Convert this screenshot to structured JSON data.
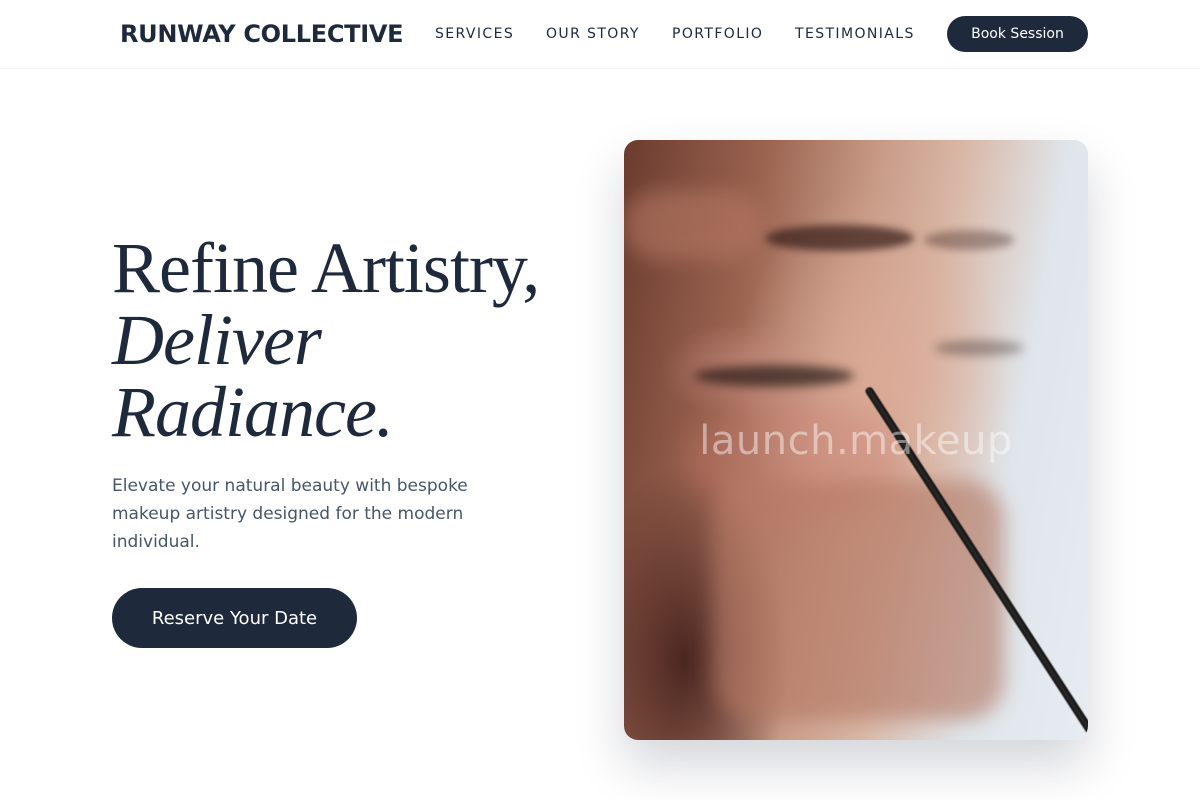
{
  "header": {
    "brand": "RUNWAY COLLECTIVE",
    "nav": [
      {
        "label": "SERVICES"
      },
      {
        "label": "OUR STORY"
      },
      {
        "label": "PORTFOLIO"
      },
      {
        "label": "TESTIMONIALS"
      }
    ],
    "book_label": "Book Session"
  },
  "hero": {
    "headline_line1": "Refine Artistry,",
    "headline_line2": "Deliver",
    "headline_line3": "Radiance.",
    "subtext": "Elevate your natural beauty with bespoke makeup artistry designed for the modern individual.",
    "cta_label": "Reserve Your Date",
    "image_watermark": "launch.makeup"
  },
  "colors": {
    "primary": "#1e293b",
    "text_muted": "#475569",
    "background": "#ffffff"
  }
}
